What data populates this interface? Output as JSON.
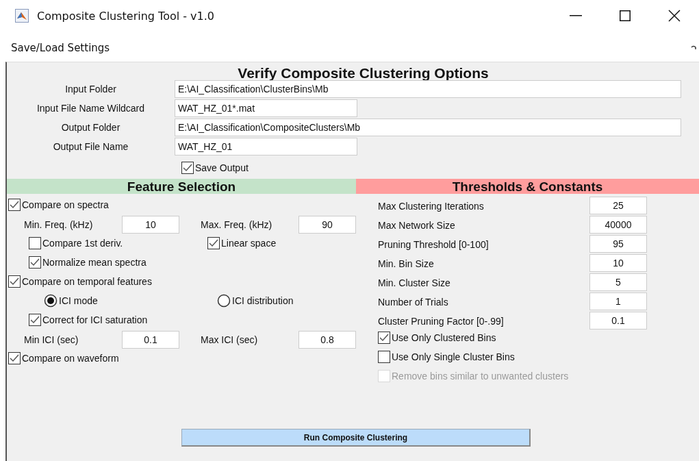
{
  "window": {
    "title": "Composite Clustering Tool - v1.0"
  },
  "menu": [
    {
      "label": "Save/Load Settings"
    }
  ],
  "heading": "Verify Composite Clustering Options",
  "file_fields": [
    {
      "label": "Input Folder",
      "value": "E:\\AI_Classification\\ClusterBins\\Mb",
      "kind": "wide"
    },
    {
      "label": "Input File Name Wildcard",
      "value": "WAT_HZ_01*.mat",
      "kind": "short"
    },
    {
      "label": "Output Folder",
      "value": "E:\\AI_Classification\\CompositeClusters\\Mb",
      "kind": "wide"
    },
    {
      "label": "Output File Name",
      "value": "WAT_HZ_01",
      "kind": "short"
    }
  ],
  "save_output": {
    "label": "Save Output",
    "checked": true
  },
  "feature_selection": {
    "title": "Feature Selection",
    "groups": [
      {
        "label": "Compare on spectra",
        "checked": true,
        "rows": [
          {
            "kind": "fields",
            "cells": [
              {
                "label": "Min. Freq. (kHz)",
                "value": "10"
              },
              {
                "label": "Max. Freq. (kHz)",
                "value": "90"
              }
            ]
          },
          {
            "kind": "checks",
            "cells": [
              {
                "label": "Compare 1st deriv.",
                "checked": false
              },
              {
                "label": "Linear space",
                "checked": true
              }
            ]
          },
          {
            "kind": "checks",
            "cells": [
              {
                "label": "Normalize mean spectra",
                "checked": true
              }
            ]
          }
        ]
      },
      {
        "label": "Compare on temporal features",
        "checked": true,
        "rows": [
          {
            "kind": "radios",
            "cells": [
              {
                "label": "ICI mode",
                "selected": true
              },
              {
                "label": "ICI distribution",
                "selected": false
              }
            ]
          },
          {
            "kind": "checks",
            "cells": [
              {
                "label": "Correct for ICI saturation",
                "checked": true
              }
            ]
          },
          {
            "kind": "fields",
            "cells": [
              {
                "label": "Min ICI (sec)",
                "value": "0.1"
              },
              {
                "label": "Max ICI (sec)",
                "value": "0.8"
              }
            ]
          }
        ]
      },
      {
        "label": "Compare on waveform",
        "checked": true
      }
    ]
  },
  "thresholds": {
    "title": "Thresholds & Constants",
    "fields": [
      {
        "label": "Max Clustering Iterations",
        "value": "25"
      },
      {
        "label": "Max Network Size",
        "value": "40000"
      },
      {
        "label": "Pruning Threshold [0-100]",
        "value": "95"
      },
      {
        "label": "Min. Bin Size",
        "value": "10"
      },
      {
        "label": "Min. Cluster Size",
        "value": "5"
      },
      {
        "label": "Number of Trials",
        "value": "1"
      },
      {
        "label": "Cluster Pruning Factor [0-.99]",
        "value": "0.1"
      }
    ],
    "options": [
      {
        "label": "Use Only Clustered Bins",
        "checked": true,
        "disabled": false
      },
      {
        "label": "Use Only Single Cluster Bins",
        "checked": false,
        "disabled": false
      },
      {
        "label": "Remove bins similar to unwanted clusters",
        "checked": false,
        "disabled": true
      }
    ]
  },
  "run_button": "Run Composite Clustering"
}
